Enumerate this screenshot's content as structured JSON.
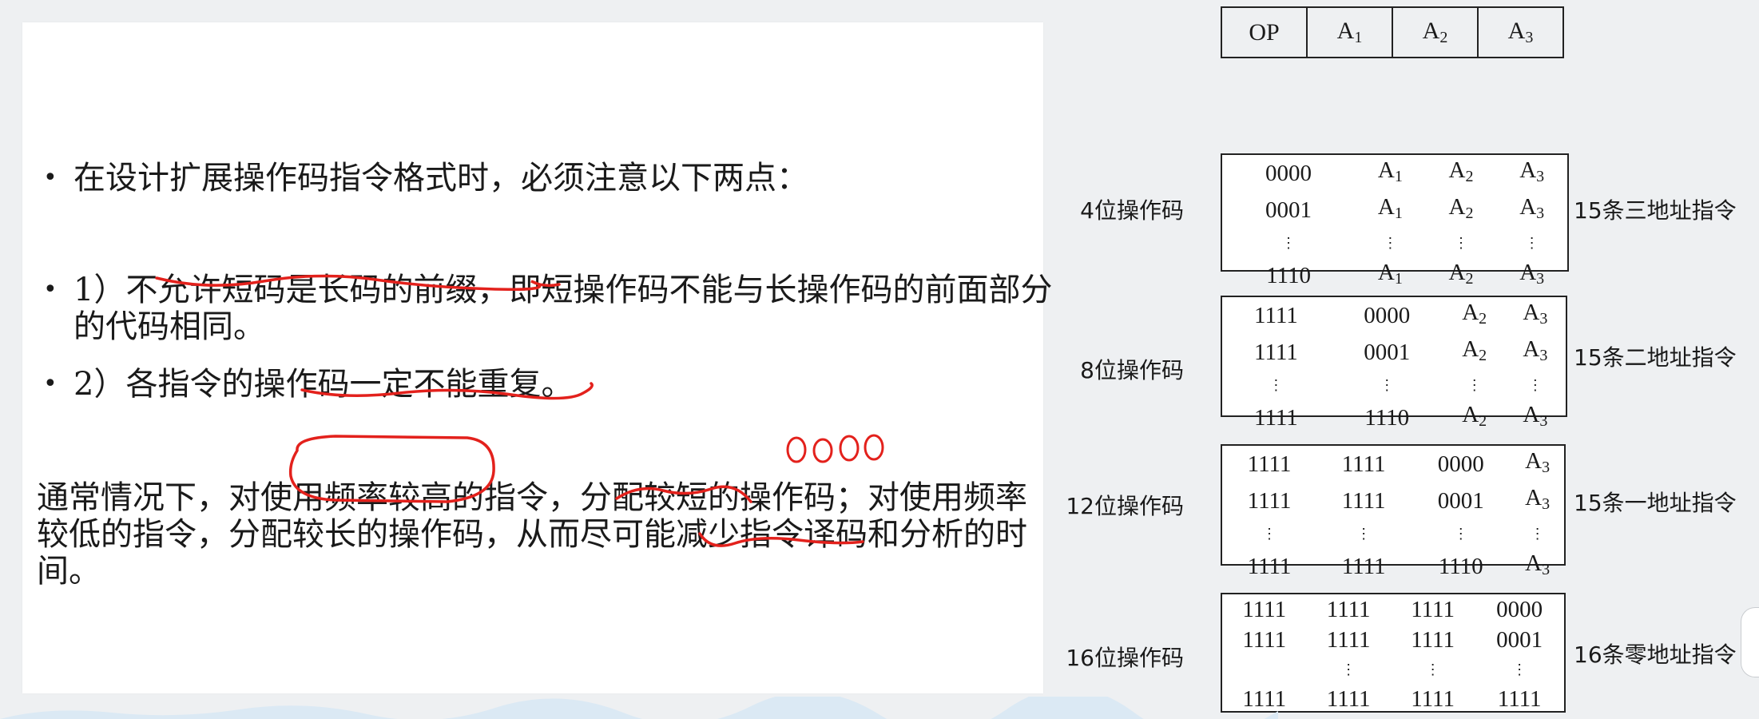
{
  "slide": {
    "bullets": [
      {
        "text": "在设计扩展操作码指令格式时，必须注意以下两点："
      },
      {
        "text": "1）不允许短码是长码的前缀，即短操作码不能与长操作码的前面部分的代码相同。"
      },
      {
        "text": "2）各指令的操作码一定不能重复。"
      }
    ],
    "paragraph": "通常情况下，对使用频率较高的指令，分配较短的操作码；对使用频率较低的指令，分配较长的操作码，从而尽可能减少指令译码和分析的时间。",
    "handwritten_note": "0000"
  },
  "figure": {
    "header": [
      "OP",
      "A1",
      "A2",
      "A3"
    ],
    "groups": [
      {
        "label": "4位操作码",
        "count": "15条三地址指令",
        "rows": [
          [
            "0000",
            "A1",
            "A2",
            "A3"
          ],
          [
            "0001",
            "A1",
            "A2",
            "A3"
          ],
          [
            "⋮",
            "⋮",
            "⋮",
            "⋮"
          ],
          [
            "1110",
            "A1",
            "A2",
            "A3"
          ]
        ]
      },
      {
        "label": "8位操作码",
        "count": "15条二地址指令",
        "rows": [
          [
            "1111",
            "0000",
            "A2",
            "A3"
          ],
          [
            "1111",
            "0001",
            "A2",
            "A3"
          ],
          [
            "⋮",
            "⋮",
            "⋮",
            "⋮"
          ],
          [
            "1111",
            "1110",
            "A2",
            "A3"
          ]
        ]
      },
      {
        "label": "12位操作码",
        "count": "15条一地址指令",
        "rows": [
          [
            "1111",
            "1111",
            "0000",
            "A3"
          ],
          [
            "1111",
            "1111",
            "0001",
            "A3"
          ],
          [
            "⋮",
            "⋮",
            "⋮",
            "⋮"
          ],
          [
            "1111",
            "1111",
            "1110",
            "A3"
          ]
        ]
      },
      {
        "label": "16位操作码",
        "count": "16条零地址指令",
        "rows": [
          [
            "1111",
            "1111",
            "1111",
            "0000"
          ],
          [
            "1111",
            "1111",
            "1111",
            "0001"
          ],
          [
            "",
            "⋮",
            "⋮",
            "⋮"
          ],
          [
            "1111",
            "1111",
            "1111",
            "1111"
          ]
        ]
      }
    ]
  },
  "colors": {
    "ink": "#e3211c",
    "background": "#eef0f2",
    "slide": "#ffffff"
  }
}
